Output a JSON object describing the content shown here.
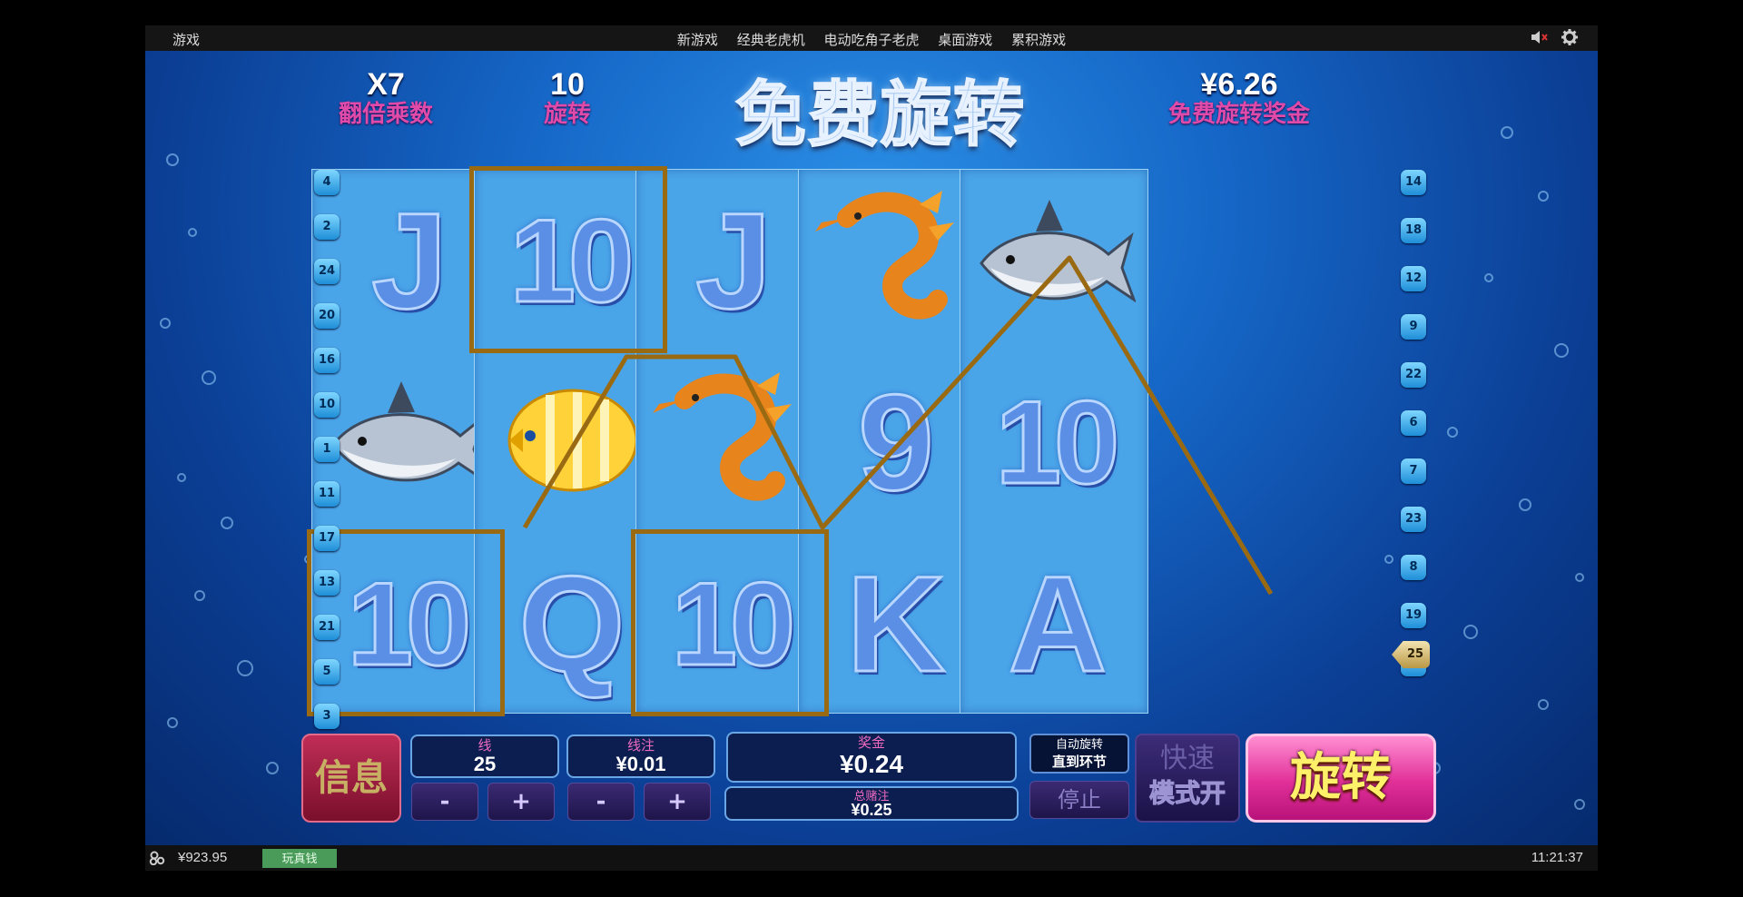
{
  "top_bar": {
    "brand": "游戏",
    "nav": [
      "新游戏",
      "经典老虎机",
      "电动吃角子老虎",
      "桌面游戏",
      "累积游戏"
    ]
  },
  "header": {
    "multiplier_value": "X7",
    "multiplier_label": "翻倍乘数",
    "spins_value": "10",
    "spins_label": "旋转",
    "title": "免费旋转",
    "bonus_value": "¥6.26",
    "bonus_label": "免费旋转奖金"
  },
  "reels": [
    [
      {
        "symbol": "J",
        "kind": "letter"
      },
      {
        "symbol": "shark",
        "kind": "animal"
      },
      {
        "symbol": "10",
        "kind": "letter"
      }
    ],
    [
      {
        "symbol": "10",
        "kind": "letter"
      },
      {
        "symbol": "angelfish",
        "kind": "animal"
      },
      {
        "symbol": "Q",
        "kind": "letter"
      }
    ],
    [
      {
        "symbol": "J",
        "kind": "letter"
      },
      {
        "symbol": "seahorse",
        "kind": "animal"
      },
      {
        "symbol": "10",
        "kind": "letter"
      }
    ],
    [
      {
        "symbol": "seahorse",
        "kind": "animal"
      },
      {
        "symbol": "9",
        "kind": "letter"
      },
      {
        "symbol": "K",
        "kind": "letter"
      }
    ],
    [
      {
        "symbol": "shark",
        "kind": "animal"
      },
      {
        "symbol": "10",
        "kind": "letter"
      },
      {
        "symbol": "A",
        "kind": "letter"
      }
    ]
  ],
  "win_highlights": [
    [
      0,
      2
    ],
    [
      1,
      0
    ],
    [
      2,
      2
    ]
  ],
  "paylines_left": [
    "4",
    "2",
    "24",
    "20",
    "16",
    "10",
    "1",
    "11",
    "17",
    "13",
    "21",
    "5",
    "3"
  ],
  "paylines_right": [
    "14",
    "18",
    "12",
    "9",
    "22",
    "6",
    "7",
    "23",
    "8",
    "19",
    "15"
  ],
  "active_payline": "25",
  "controls": {
    "info_label": "信息",
    "lines_label": "线",
    "lines_value": "25",
    "line_bet_label": "线注",
    "line_bet_value": "¥0.01",
    "minus": "-",
    "plus": "+",
    "win_label": "奖金",
    "win_value": "¥0.24",
    "total_bet_label": "总赌注",
    "total_bet_value": "¥0.25",
    "autospin_line1": "自动旋转",
    "autospin_line2": "直到环节",
    "stop_label": "停止",
    "turbo_line1": "快速",
    "turbo_line2": "模式开",
    "spin_label": "旋转"
  },
  "bottom_bar": {
    "balance": "¥923.95",
    "real_money_button": "玩真钱",
    "clock": "11:21:37"
  },
  "colors": {
    "highlight": "#9a6a13",
    "label_pink": "#e04aa8",
    "spin_pink": "#e12f98"
  }
}
